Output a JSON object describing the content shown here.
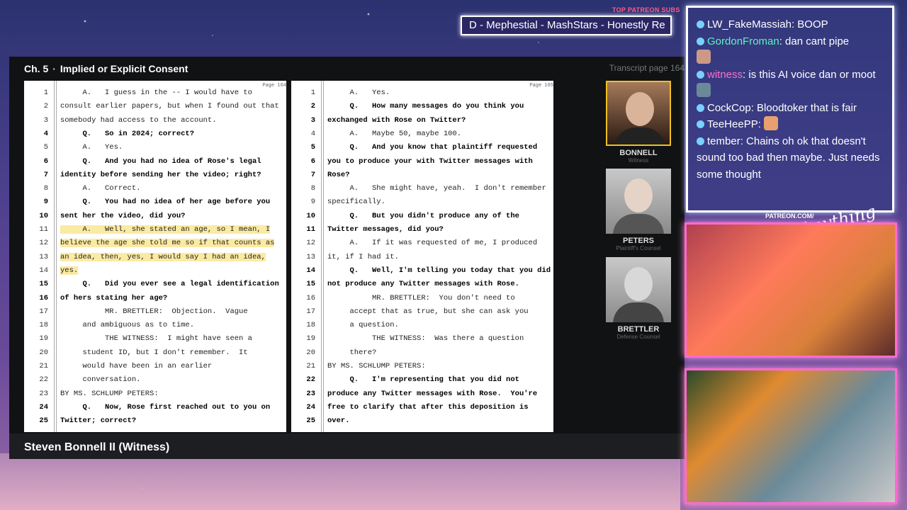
{
  "top_subs": {
    "label": "TOP PATREON SUBS",
    "text": "D - Mephestial - MashStars - Honestly Re"
  },
  "header": {
    "chapter": "Ch. 5",
    "separator": "·",
    "title": "Implied or Explicit Consent",
    "transcript_page": "Transcript page 164"
  },
  "left_page": {
    "page_no": "Page 164",
    "lines": [
      {
        "n": "1",
        "t": "     A.   I guess in the -- I would have to"
      },
      {
        "n": "2",
        "t": "consult earlier papers, but when I found out that"
      },
      {
        "n": "3",
        "t": "somebody had access to the account."
      },
      {
        "n": "4",
        "t": "     Q.   So in 2024; correct?",
        "b": true
      },
      {
        "n": "5",
        "t": "     A.   Yes."
      },
      {
        "n": "6",
        "t": "     Q.   And you had no idea of Rose's legal",
        "b": true
      },
      {
        "n": "7",
        "t": "identity before sending her the video; right?",
        "b": true
      },
      {
        "n": "8",
        "t": "     A.   Correct."
      },
      {
        "n": "9",
        "t": "     Q.   You had no idea of her age before you",
        "b": true
      },
      {
        "n": "10",
        "t": "sent her the video, did you?",
        "b": true
      },
      {
        "n": "11",
        "t": "     A.   Well, she stated an age, so I mean, I",
        "hl": true
      },
      {
        "n": "12",
        "t": "believe the age she told me so if that counts as",
        "hl": true
      },
      {
        "n": "13",
        "t": "an idea, then, yes, I would say I had an idea,",
        "hl": true
      },
      {
        "n": "14",
        "t": "yes.",
        "hl": true
      },
      {
        "n": "15",
        "t": "     Q.   Did you ever see a legal identification",
        "b": true
      },
      {
        "n": "16",
        "t": "of hers stating her age?",
        "b": true
      },
      {
        "n": "17",
        "t": "          MR. BRETTLER:  Objection.  Vague"
      },
      {
        "n": "18",
        "t": "     and ambiguous as to time."
      },
      {
        "n": "19",
        "t": "          THE WITNESS:  I might have seen a"
      },
      {
        "n": "20",
        "t": "     student ID, but I don't remember.  It"
      },
      {
        "n": "21",
        "t": "     would have been in an earlier"
      },
      {
        "n": "22",
        "t": "     conversation."
      },
      {
        "n": "23",
        "t": "BY MS. SCHLUMP PETERS:"
      },
      {
        "n": "24",
        "t": "     Q.   Now, Rose first reached out to you on",
        "b": true
      },
      {
        "n": "25",
        "t": "Twitter; correct?",
        "b": true
      }
    ]
  },
  "right_page": {
    "page_no": "Page 165",
    "lines": [
      {
        "n": "1",
        "t": "     A.   Yes."
      },
      {
        "n": "2",
        "t": "     Q.   How many messages do you think you",
        "b": true
      },
      {
        "n": "3",
        "t": "exchanged with Rose on Twitter?",
        "b": true
      },
      {
        "n": "4",
        "t": "     A.   Maybe 50, maybe 100."
      },
      {
        "n": "5",
        "t": "     Q.   And you know that plaintiff requested",
        "b": true
      },
      {
        "n": "6",
        "t": "you to produce your with Twitter messages with",
        "b": true
      },
      {
        "n": "7",
        "t": "Rose?",
        "b": true
      },
      {
        "n": "8",
        "t": "     A.   She might have, yeah.  I don't remember"
      },
      {
        "n": "9",
        "t": "specifically."
      },
      {
        "n": "10",
        "t": "     Q.   But you didn't produce any of the",
        "b": true
      },
      {
        "n": "11",
        "t": "Twitter messages, did you?",
        "b": true
      },
      {
        "n": "12",
        "t": "     A.   If it was requested of me, I produced"
      },
      {
        "n": "13",
        "t": "it, if I had it."
      },
      {
        "n": "14",
        "t": "     Q.   Well, I'm telling you today that you did",
        "b": true
      },
      {
        "n": "15",
        "t": "not produce any Twitter messages with Rose.",
        "b": true
      },
      {
        "n": "16",
        "t": "          MR. BRETTLER:  You don't need to"
      },
      {
        "n": "17",
        "t": "     accept that as true, but she can ask you"
      },
      {
        "n": "18",
        "t": "     a question."
      },
      {
        "n": "19",
        "t": "          THE WITNESS:  Was there a question"
      },
      {
        "n": "20",
        "t": "     there?"
      },
      {
        "n": "21",
        "t": "BY MS. SCHLUMP PETERS:"
      },
      {
        "n": "22",
        "t": "     Q.   I'm representing that you did not",
        "b": true
      },
      {
        "n": "23",
        "t": "produce any Twitter messages with Rose.  You're",
        "b": true
      },
      {
        "n": "24",
        "t": "free to clarify that after this deposition is",
        "b": true
      },
      {
        "n": "25",
        "t": "over.",
        "b": true
      }
    ]
  },
  "footer": {
    "speaker": "Steven Bonnell II (Witness)"
  },
  "participants": [
    {
      "name": "BONNELL",
      "role": "Witness"
    },
    {
      "name": "PETERS",
      "role": "Plaintiff's Counsel"
    },
    {
      "name": "BRETTLER",
      "role": "Defense Counsel"
    }
  ],
  "chat": [
    {
      "user": "LW_FakeMassiah",
      "text": " BOOP"
    },
    {
      "user": "GordonFroman",
      "text": " dan cant pipe"
    },
    {
      "user": "witness",
      "text": " is this AI voice dan or moot"
    },
    {
      "user": "CockCop",
      "text": " Bloodtoker that is fair"
    },
    {
      "user": "TeeHeePP",
      "text": ""
    },
    {
      "user": "tember",
      "text": " Chains oh ok that doesn't sound too bad then maybe. Just needs some thought"
    }
  ],
  "overlay": {
    "patreon": "PATREON.COM/",
    "logo": "Anything Else"
  }
}
